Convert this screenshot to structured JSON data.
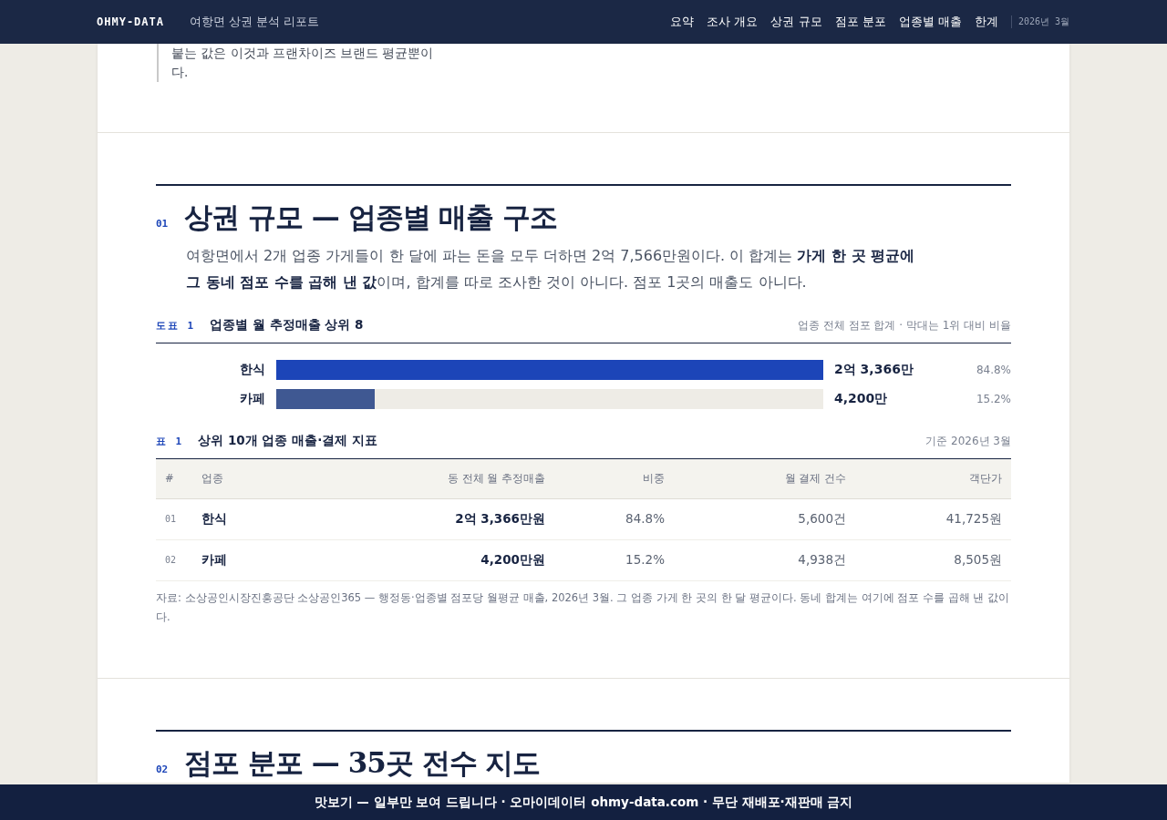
{
  "header": {
    "logo": "OHMY-DATA",
    "subtitle": "여항면 상권 분석 리포트",
    "nav": [
      {
        "label": "요약"
      },
      {
        "label": "조사 개요"
      },
      {
        "label": "상권 규모"
      },
      {
        "label": "점포 분포"
      },
      {
        "label": "업종별 매출"
      },
      {
        "label": "한계"
      }
    ],
    "date": "2026년 3월"
  },
  "quote": "붙는 값은 이것과 프랜차이즈 브랜드 평균뿐이다.",
  "sections": [
    {
      "number": "01",
      "title": "상권 규모 — 업종별 매출 구조",
      "lead": "여항면에서 2개 업종 가게들이 한 달에 파는 돈을 모두 더하면 2억 7,566만원이다. 이 합계는 **가게 한 곳 평균에 그 동네 점포 수를 곱해 낸 값**이며, 합계를 따로 조사한 것이 아니다. 점포 1곳의 매출도 아니다.",
      "figure": {
        "tag": "도표 1",
        "title": "업종별 월 추정매출 상위 8",
        "note": "업종 전체 점포 합계 · 막대는 1위 대비 비율",
        "bars": [
          {
            "label": "한식",
            "value": "2억 3,366만",
            "share": "84.8%",
            "level": 1,
            "color": "#1c45b8"
          },
          {
            "label": "카페",
            "value": "4,200만",
            "share": "15.2%",
            "level": 0.18,
            "color": "#3f5892"
          }
        ]
      },
      "table": {
        "tag": "표 1",
        "title": "상위 10개 업종 매출·결제 지표",
        "note": "기준 2026년 3월",
        "columns": [
          "#",
          "업종",
          "동 전체 월 추정매출",
          "비중",
          "월 결제 건수",
          "객단가"
        ],
        "rows": [
          [
            "01",
            "한식",
            "2억 3,366만원",
            "84.8%",
            "5,600건",
            "41,725원"
          ],
          [
            "02",
            "카페",
            "4,200만원",
            "15.2%",
            "4,938건",
            "8,505원"
          ]
        ],
        "source": "자료: 소상공인시장진흥공단 소상공인365 — 행정동·업종별 점포당 월평균 매출, 2026년 3월. 그 업종 가게 한 곳의 한 달 평균이다. 동네 합계는 여기에 점포 수를 곱해 낸 값이다."
      }
    },
    {
      "number": "02",
      "title": "점포 분포 — 35곳 전수 지도"
    }
  ],
  "banner": "맛보기 — 일부만 보여 드립니다 · 오마이데이터 ohmy-data.com · 무단 재배포·재판매 금지"
}
